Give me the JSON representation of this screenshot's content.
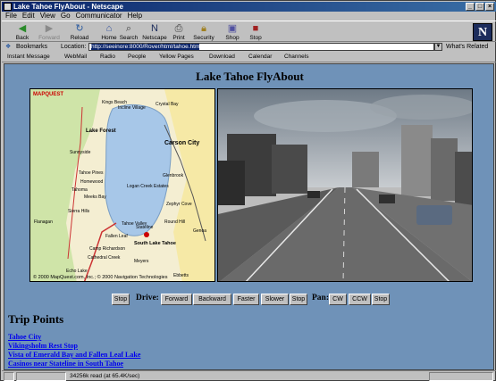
{
  "window": {
    "title": "Lake Tahoe FlyAbout - Netscape"
  },
  "menu": [
    "File",
    "Edit",
    "View",
    "Go",
    "Communicator",
    "Help"
  ],
  "toolbar": {
    "buttons": [
      {
        "label": "Back",
        "icon": "back-arrow-icon"
      },
      {
        "label": "Forward",
        "icon": "forward-arrow-icon"
      },
      {
        "label": "Reload",
        "icon": "reload-icon"
      },
      {
        "label": "Home",
        "icon": "home-icon"
      },
      {
        "label": "Search",
        "icon": "search-icon"
      },
      {
        "label": "Netscape",
        "icon": "netscape-icon"
      },
      {
        "label": "Print",
        "icon": "print-icon"
      },
      {
        "label": "Security",
        "icon": "security-lock-icon"
      },
      {
        "label": "Shop",
        "icon": "shop-bag-icon"
      },
      {
        "label": "Stop",
        "icon": "stop-icon"
      }
    ],
    "logo": "N"
  },
  "location": {
    "bookmarks_label": "Bookmarks",
    "location_label": "Location:",
    "url": "http://seeinore:8000/Rover/html/tahoe.htm",
    "related_label": "What's Related"
  },
  "personal_toolbar": [
    "Instant Message",
    "WebMail",
    "Radio",
    "People",
    "Yellow Pages",
    "Download",
    "Calendar",
    "Channels"
  ],
  "page": {
    "title": "Lake Tahoe FlyAbout",
    "map": {
      "brand": "MAPQUEST",
      "copyright": "© 2000 MapQuest.com, Inc.; © 2000 Navigation Technologies",
      "places": [
        "Incline Village",
        "Kings Beach",
        "Lake Forest",
        "Carson City",
        "Sunnyside",
        "Tahoe Pines",
        "Homewood",
        "Meeks Bay",
        "Tahoma",
        "Stateline",
        "South Lake Tahoe",
        "Tahoe Valley",
        "Meyers",
        "Camp Richardson",
        "Zephyr Cove",
        "Glenbrook",
        "Logan Creek Estates",
        "Cathedral Creek",
        "Echo Lake",
        "Fallen Leaf",
        "Sierra Hills",
        "Ebbetts",
        "Genoa",
        "Round Hill",
        "Crystal Bay",
        "Flanagan"
      ]
    },
    "controls": {
      "stop_left": "Stop",
      "drive_label": "Drive:",
      "drive_buttons": [
        "Forward",
        "Backward",
        "Faster",
        "Slower",
        "Stop"
      ],
      "pan_label": "Pan:",
      "pan_buttons": [
        "CW",
        "CCW",
        "Stop"
      ]
    },
    "trip_points_title": "Trip Points",
    "trip_points": [
      "Tahoe City",
      "Vikingsholm Rest Stop",
      "Vista of Emerald Bay and Fallen Leaf Lake",
      "Casinos near Stateline in South Tahoe"
    ]
  },
  "status": {
    "text": "34256k read (at 65.4K/sec)"
  }
}
